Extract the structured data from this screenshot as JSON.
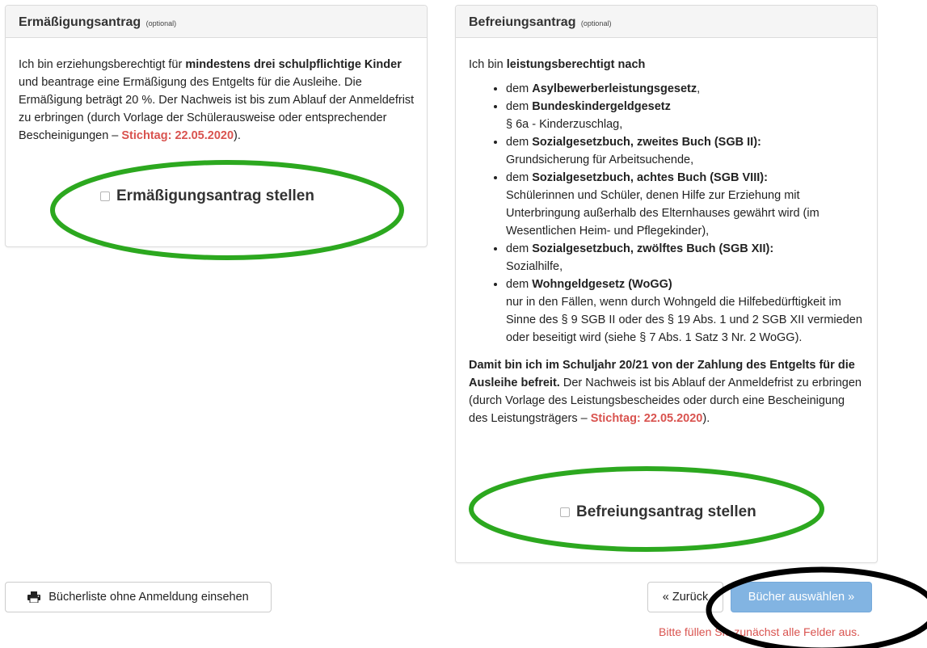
{
  "left_panel": {
    "title": "Ermäßigungsantrag",
    "optional": "(optional)",
    "text_1": "Ich bin erziehungsberechtigt für ",
    "text_bold": "mindestens drei schulpflichtige Kinder",
    "text_2": " und beantrage eine Ermäßigung des Entgelts für die Ausleihe. Die Ermäßigung beträgt 20 %. Der Nachweis ist bis zum Ablauf der Anmeldefrist zu erbringen (durch Vorlage der Schülerausweise oder entsprechender Bescheinigungen – ",
    "deadline": "Stichtag: 22.05.2020",
    "text_end": ").",
    "checkbox_label": "Ermäßigungsantrag stellen",
    "checkbox_checked": false
  },
  "right_panel": {
    "title": "Befreiungsantrag",
    "optional": "(optional)",
    "intro_1": "Ich bin ",
    "intro_bold": "leistungsberechtigt nach",
    "items": [
      {
        "pre": "dem ",
        "bold": "Asylbewerberleistungsgesetz",
        "post": ",",
        "sub": ""
      },
      {
        "pre": "dem ",
        "bold": "Bundeskindergeldgesetz",
        "post": "",
        "sub": "§ 6a - Kinderzuschlag,"
      },
      {
        "pre": "dem ",
        "bold": "Sozialgesetzbuch, zweites Buch (SGB II):",
        "post": "",
        "sub": "Grundsicherung für Arbeitsuchende,"
      },
      {
        "pre": "dem ",
        "bold": "Sozialgesetzbuch, achtes Buch (SGB VIII):",
        "post": "",
        "sub": "Schülerinnen und Schüler, denen Hilfe zur Erziehung mit Unterbringung außerhalb des Elternhauses gewährt wird (im Wesentlichen Heim- und Pflegekinder),"
      },
      {
        "pre": "dem ",
        "bold": "Sozialgesetzbuch, zwölftes Buch (SGB XII):",
        "post": "",
        "sub": "Sozialhilfe,"
      },
      {
        "pre": "dem ",
        "bold": "Wohngeldgesetz (WoGG)",
        "post": "",
        "sub": "nur in den Fällen, wenn durch Wohngeld die Hilfebedürftigkeit im Sinne des § 9 SGB II oder des § 19 Abs. 1 und 2 SGB XII vermieden oder beseitigt wird (siehe § 7 Abs. 1 Satz 3 Nr. 2 WoGG)."
      }
    ],
    "outro_bold": "Damit bin ich im Schuljahr 20/21 von der Zahlung des Entgelts für die Ausleihe befreit.",
    "outro_text": " Der Nachweis ist bis Ablauf der Anmeldefrist zu erbringen (durch Vorlage des Leistungsbescheides oder durch eine Bescheinigung des Leistungsträgers – ",
    "deadline": "Stichtag: 22.05.2020",
    "outro_end": ").",
    "checkbox_label": "Befreiungsantrag stellen",
    "checkbox_checked": false
  },
  "footer": {
    "booklist_button": "Bücherliste ohne Anmeldung einsehen",
    "booklist_icon": "printer-icon",
    "back_button": "« Zurück",
    "next_button": "Bücher auswählen »",
    "error_message": "Bitte füllen Sie zunächst alle Felder aus."
  },
  "annotations": {
    "green_color": "#2ca81f",
    "black_color": "#000000"
  }
}
